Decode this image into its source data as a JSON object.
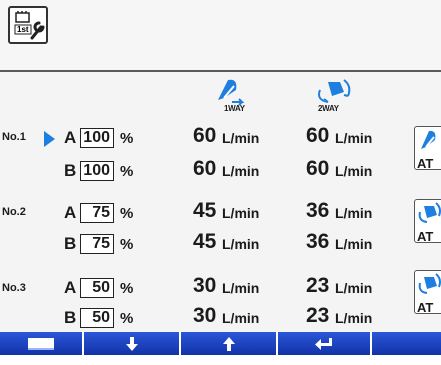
{
  "header": {
    "mode_icon": "maintenance-1st-wrench-icon"
  },
  "columns": {
    "oneway_label": "1WAY",
    "twoway_label": "2WAY"
  },
  "unit": "L/min",
  "percent": "%",
  "rows": [
    {
      "no": "No.1",
      "a": {
        "label": "A",
        "value": "100",
        "oneway": "60",
        "twoway": "60"
      },
      "b": {
        "label": "B",
        "value": "100",
        "oneway": "60",
        "twoway": "60"
      },
      "selected": true
    },
    {
      "no": "No.2",
      "a": {
        "label": "A",
        "value": "75",
        "oneway": "45",
        "twoway": "36"
      },
      "b": {
        "label": "B",
        "value": "75",
        "oneway": "45",
        "twoway": "36"
      }
    },
    {
      "no": "No.3",
      "a": {
        "label": "A",
        "value": "50",
        "oneway": "30",
        "twoway": "23"
      },
      "b": {
        "label": "B",
        "value": "50",
        "oneway": "30",
        "twoway": "23"
      }
    }
  ],
  "side_buttons": [
    {
      "label": "AT",
      "icon": "1way-attachment-icon"
    },
    {
      "label": "AT",
      "icon": "2way-attachment-icon"
    },
    {
      "label": "AT",
      "icon": "2way-attachment-icon"
    }
  ],
  "function_keys": [
    {
      "icon": "display-icon"
    },
    {
      "icon": "arrow-down-icon"
    },
    {
      "icon": "arrow-up-icon"
    },
    {
      "icon": "enter-icon"
    },
    {
      "icon": "blank-key"
    }
  ],
  "colors": {
    "accent_blue": "#1e7fe0",
    "key_blue": "#1a3fc0"
  }
}
